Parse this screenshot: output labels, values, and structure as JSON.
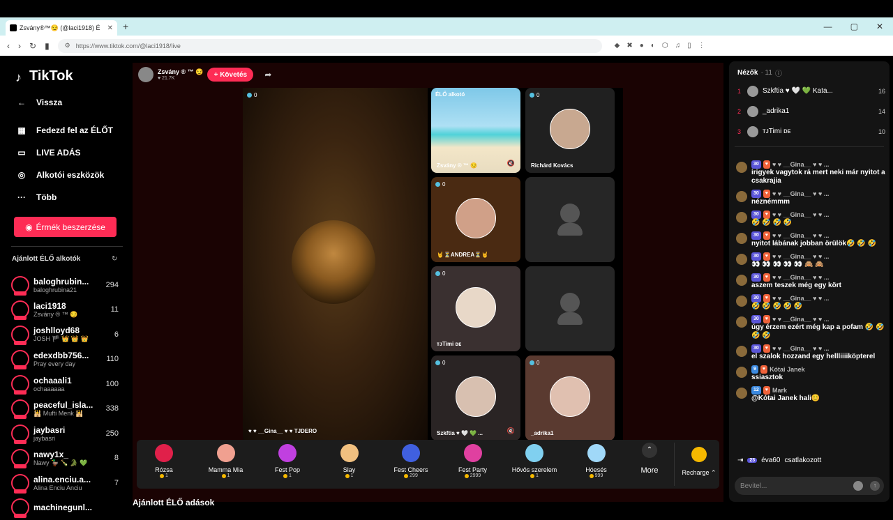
{
  "browser": {
    "tab_title": "Zsvány®™😏 (@laci1918) É",
    "url": "https://www.tiktok.com/@laci1918/live"
  },
  "sidebar": {
    "logo": "TikTok",
    "nav": [
      {
        "label": "Vissza",
        "icon": "arrow-left-icon"
      },
      {
        "label": "Fedezd fel az ÉLŐT",
        "icon": "calendar-icon"
      },
      {
        "label": "LIVE ADÁS",
        "icon": "camera-icon"
      },
      {
        "label": "Alkotói eszközök",
        "icon": "lightbulb-icon"
      },
      {
        "label": "Több",
        "icon": "ellipsis-icon"
      }
    ],
    "coins_button": "Érmék beszerzése",
    "recommended_title": "Ajánlott ÉLŐ alkotók",
    "creators": [
      {
        "name": "baloghrubin...",
        "sub": "baloghrubina21",
        "count": "294"
      },
      {
        "name": "laci1918",
        "sub": "Zsvány ® ™ 😏",
        "count": "11"
      },
      {
        "name": "joshlloyd68",
        "sub": "JOSH 🏴 👑 👑 👑",
        "count": "6"
      },
      {
        "name": "edexdbb756...",
        "sub": "Pray every day",
        "count": "110"
      },
      {
        "name": "ochaaali1",
        "sub": "ochaaaaaa",
        "count": "100"
      },
      {
        "name": "peaceful_isla...",
        "sub": "🕌 Mufti Menk 🕌",
        "count": "338"
      },
      {
        "name": "jaybasri",
        "sub": "jaybasri",
        "count": "250"
      },
      {
        "name": "nawy1x_",
        "sub": "Nawy 🦆 🍾 🐊 💚",
        "count": "8"
      },
      {
        "name": "alina.enciu.a...",
        "sub": "Alina Enciu Anciu",
        "count": "7"
      },
      {
        "name": "machinegunl...",
        "sub": "",
        "count": ""
      }
    ]
  },
  "host": {
    "name": "Zsvány ® ™ 😏",
    "likes": "21.7K",
    "follow": "+ Követés"
  },
  "stage": {
    "big_tile": {
      "badge": "0",
      "name": "♥ ♥ __Gina__ ♥ ♥ TJDERO"
    },
    "tiles": [
      {
        "badge": "ÉLŐ alkotó",
        "name": "Zsvány ® ™ 😏"
      },
      {
        "badge": "0",
        "name": "Richárd Kovács"
      },
      {
        "badge": "0",
        "name": "🤘⏳ANDREA⏳🤘"
      },
      {
        "badge": "",
        "name": ""
      },
      {
        "badge": "0",
        "name": "ᴛᴊTimi ᴅᴇ"
      },
      {
        "badge": "",
        "name": ""
      },
      {
        "badge": "0",
        "name": "Szkftia ♥ 🤍 💚 ..."
      },
      {
        "badge": "0",
        "name": "_adrika1"
      }
    ]
  },
  "gifts": [
    {
      "name": "Rózsa",
      "price": "1",
      "color": "#e0204a"
    },
    {
      "name": "Mamma Mia",
      "price": "1",
      "color": "#f0a090"
    },
    {
      "name": "Fest Pop",
      "price": "1",
      "color": "#c040e0"
    },
    {
      "name": "Slay",
      "price": "1",
      "color": "#f0c080"
    },
    {
      "name": "Fest Cheers",
      "price": "299",
      "color": "#4060e0"
    },
    {
      "name": "Fest Party",
      "price": "2999",
      "color": "#e040a0"
    },
    {
      "name": "Hővös szerelem",
      "price": "1",
      "color": "#80d0f0"
    },
    {
      "name": "Hóesés",
      "price": "999",
      "color": "#a0d8f8"
    }
  ],
  "more_label": "More",
  "recharge_label": "Recharge ⌃",
  "below_title": "Ajánlott ÉLŐ adások",
  "chat": {
    "title": "Nézők",
    "viewer_count": "· 11",
    "top_viewers": [
      {
        "rank": "1",
        "name": "Szkftia ♥ 🤍 💚 Kata...",
        "score": "16"
      },
      {
        "rank": "2",
        "name": "_adrika1",
        "score": "14"
      },
      {
        "rank": "3",
        "name": "ᴛᴊTimi ᴅᴇ",
        "score": "10"
      }
    ],
    "messages": [
      {
        "level": "30",
        "user": "♥ ♥ __Gina__ ♥ ♥ ...",
        "text": "irigyek vagytok rá mert neki már nyitot a csakrajia"
      },
      {
        "level": "30",
        "user": "♥ ♥ __Gina__ ♥ ♥ ...",
        "text": "néznémmm"
      },
      {
        "level": "30",
        "user": "♥ ♥ __Gina__ ♥ ♥ ...",
        "text": "🤣 🤣 🤣 🤣"
      },
      {
        "level": "30",
        "user": "♥ ♥ __Gina__ ♥ ♥ ...",
        "text": "nyitot lábának jobban örülök🤣 🤣 🤣"
      },
      {
        "level": "30",
        "user": "♥ ♥ __Gina__ ♥ ♥ ...",
        "text": "👀 👀 👀 👀 👀 🙈 🙈"
      },
      {
        "level": "30",
        "user": "♥ ♥ __Gina__ ♥ ♥ ...",
        "text": "aszem teszek még egy kört"
      },
      {
        "level": "30",
        "user": "♥ ♥ __Gina__ ♥ ♥ ...",
        "text": "🤣 🤣 🤣 🤣 🤣"
      },
      {
        "level": "30",
        "user": "♥ ♥ __Gina__ ♥ ♥ ...",
        "text": "úgy érzem ezért még kap a pofam 🤣 🤣 🤣 🤣"
      },
      {
        "level": "30",
        "user": "♥ ♥ __Gina__ ♥ ♥ ...",
        "text": "el szalok hozzand egy hellliiiiköpterel"
      },
      {
        "level": "9",
        "user": "Kótai Janek",
        "text": "ssiasztok"
      },
      {
        "level": "12",
        "user": "Mark",
        "text": "@Kótai Janek hali😊"
      }
    ],
    "joined_level": "23",
    "joined_user": "éva60",
    "joined_text": "csatlakozott",
    "input_placeholder": "Bevitel..."
  }
}
